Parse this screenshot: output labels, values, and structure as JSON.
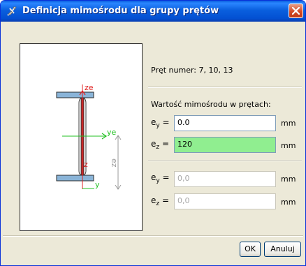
{
  "window": {
    "title": "Definicja mimośrodu dla grupy prętów",
    "colors": {
      "titlebar": "#0a5fde",
      "close": "#d34a26",
      "highlight_field": "#90ee90"
    }
  },
  "preview": {
    "labels": {
      "ze": "ze",
      "ye": "ye",
      "z": "z",
      "y": "y",
      "ez": "ez"
    },
    "colors": {
      "flange": "#8ab4d8",
      "web": "#b03030",
      "z_axis": "#e02020",
      "y_axis": "#20c020",
      "dimension": "#9a9a9a"
    }
  },
  "member": {
    "label": "Pręt numer: 7, 10, 13"
  },
  "eccentricity": {
    "heading": "Wartość mimośrodu w prętach:",
    "rows": [
      {
        "sym": "e",
        "sub": "y",
        "eq": "=",
        "value": "0.0",
        "unit": "mm",
        "state": "normal"
      },
      {
        "sym": "e",
        "sub": "z",
        "eq": "=",
        "value": "120",
        "unit": "mm",
        "state": "highlight"
      },
      {
        "sym": "e",
        "sub": "y",
        "eq": "=",
        "value": "",
        "placeholder": "0,0",
        "unit": "mm",
        "state": "disabled"
      },
      {
        "sym": "e",
        "sub": "z",
        "eq": "=",
        "value": "",
        "placeholder": "0,0",
        "unit": "mm",
        "state": "disabled"
      }
    ]
  },
  "buttons": {
    "ok": "OK",
    "cancel": "Anuluj"
  }
}
